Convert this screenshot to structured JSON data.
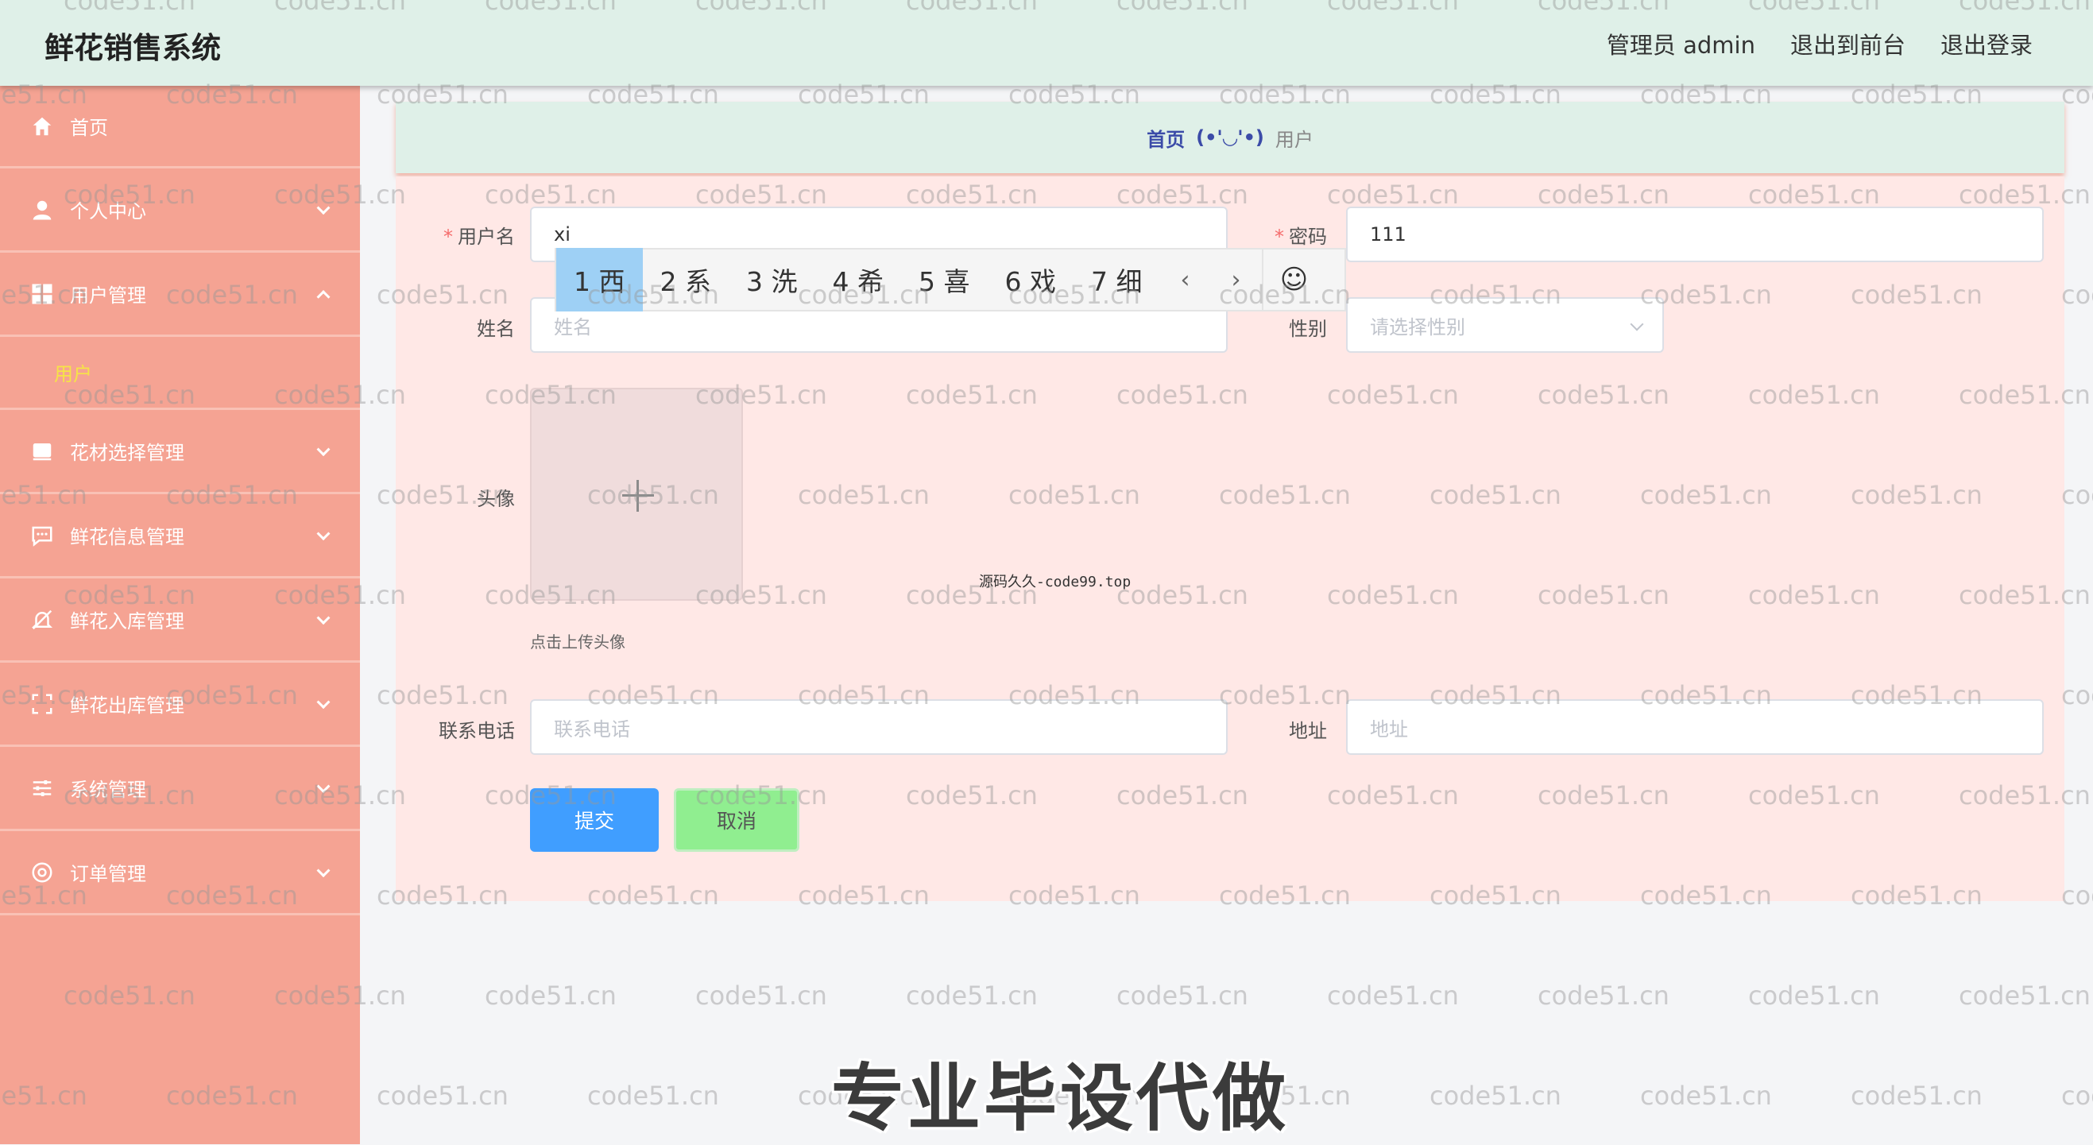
{
  "header": {
    "title": "鲜花销售系统",
    "admin_label": "管理员 admin",
    "front_label": "退出到前台",
    "logout_label": "退出登录"
  },
  "sidebar": {
    "items": [
      {
        "label": "首页",
        "icon": "home-icon"
      },
      {
        "label": "个人中心",
        "icon": "person-icon"
      },
      {
        "label": "用户管理",
        "icon": "grid-icon",
        "expanded": true
      },
      {
        "label": "花材选择管理",
        "icon": "box-icon"
      },
      {
        "label": "鲜花信息管理",
        "icon": "chat-icon"
      },
      {
        "label": "鲜花入库管理",
        "icon": "bell-off-icon"
      },
      {
        "label": "鲜花出库管理",
        "icon": "expand-icon"
      },
      {
        "label": "系统管理",
        "icon": "sliders-icon"
      },
      {
        "label": "订单管理",
        "icon": "at-icon"
      }
    ],
    "sub_item": "用户"
  },
  "breadcrumb": {
    "home": "首页",
    "sep": "(•'◡'•)",
    "current": "用户"
  },
  "form": {
    "username_label": "用户名",
    "username_value": "xi",
    "password_label": "密码",
    "password_value": "111",
    "name_label": "姓名",
    "name_placeholder": "姓名",
    "gender_label": "性别",
    "gender_placeholder": "请选择性别",
    "avatar_label": "头像",
    "upload_tip": "点击上传头像",
    "phone_label": "联系电话",
    "phone_placeholder": "联系电话",
    "address_label": "地址",
    "address_placeholder": "地址",
    "submit_label": "提交",
    "cancel_label": "取消"
  },
  "ime": {
    "candidates": [
      "1 西",
      "2 系",
      "3 洗",
      "4 希",
      "5 喜",
      "6 戏",
      "7 细"
    ],
    "prev": "‹",
    "next": "›",
    "emoji": "☺"
  },
  "overlay": {
    "watermark": "code51.cn",
    "center_note": "源码久久-code99.top",
    "banner": "专业毕设代做"
  },
  "colors": {
    "sidebar": "#f5a393",
    "header": "#dff0e8",
    "panel": "#ffe8e6",
    "submit": "#409eff",
    "cancel": "#90ee90",
    "submenu_active": "#f6e347"
  }
}
